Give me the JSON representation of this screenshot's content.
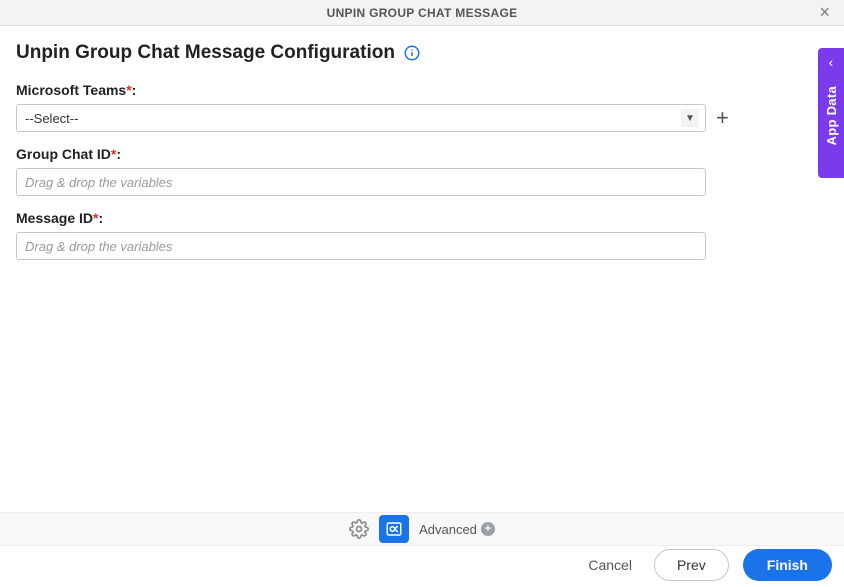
{
  "header": {
    "title": "UNPIN GROUP CHAT MESSAGE"
  },
  "page": {
    "title": "Unpin Group Chat Message Configuration"
  },
  "form": {
    "teams_label": "Microsoft Teams",
    "select_placeholder": "--Select--",
    "group_chat_label": "Group Chat ID",
    "group_chat_placeholder": "Drag & drop the variables",
    "message_id_label": "Message ID",
    "message_id_placeholder": "Drag & drop the variables"
  },
  "side": {
    "app_data": "App Data"
  },
  "footer": {
    "advanced": "Advanced"
  },
  "buttons": {
    "cancel": "Cancel",
    "prev": "Prev",
    "finish": "Finish"
  },
  "colors": {
    "accent": "#1a73e8",
    "side_tab": "#7c3aed",
    "danger": "#d93025"
  }
}
